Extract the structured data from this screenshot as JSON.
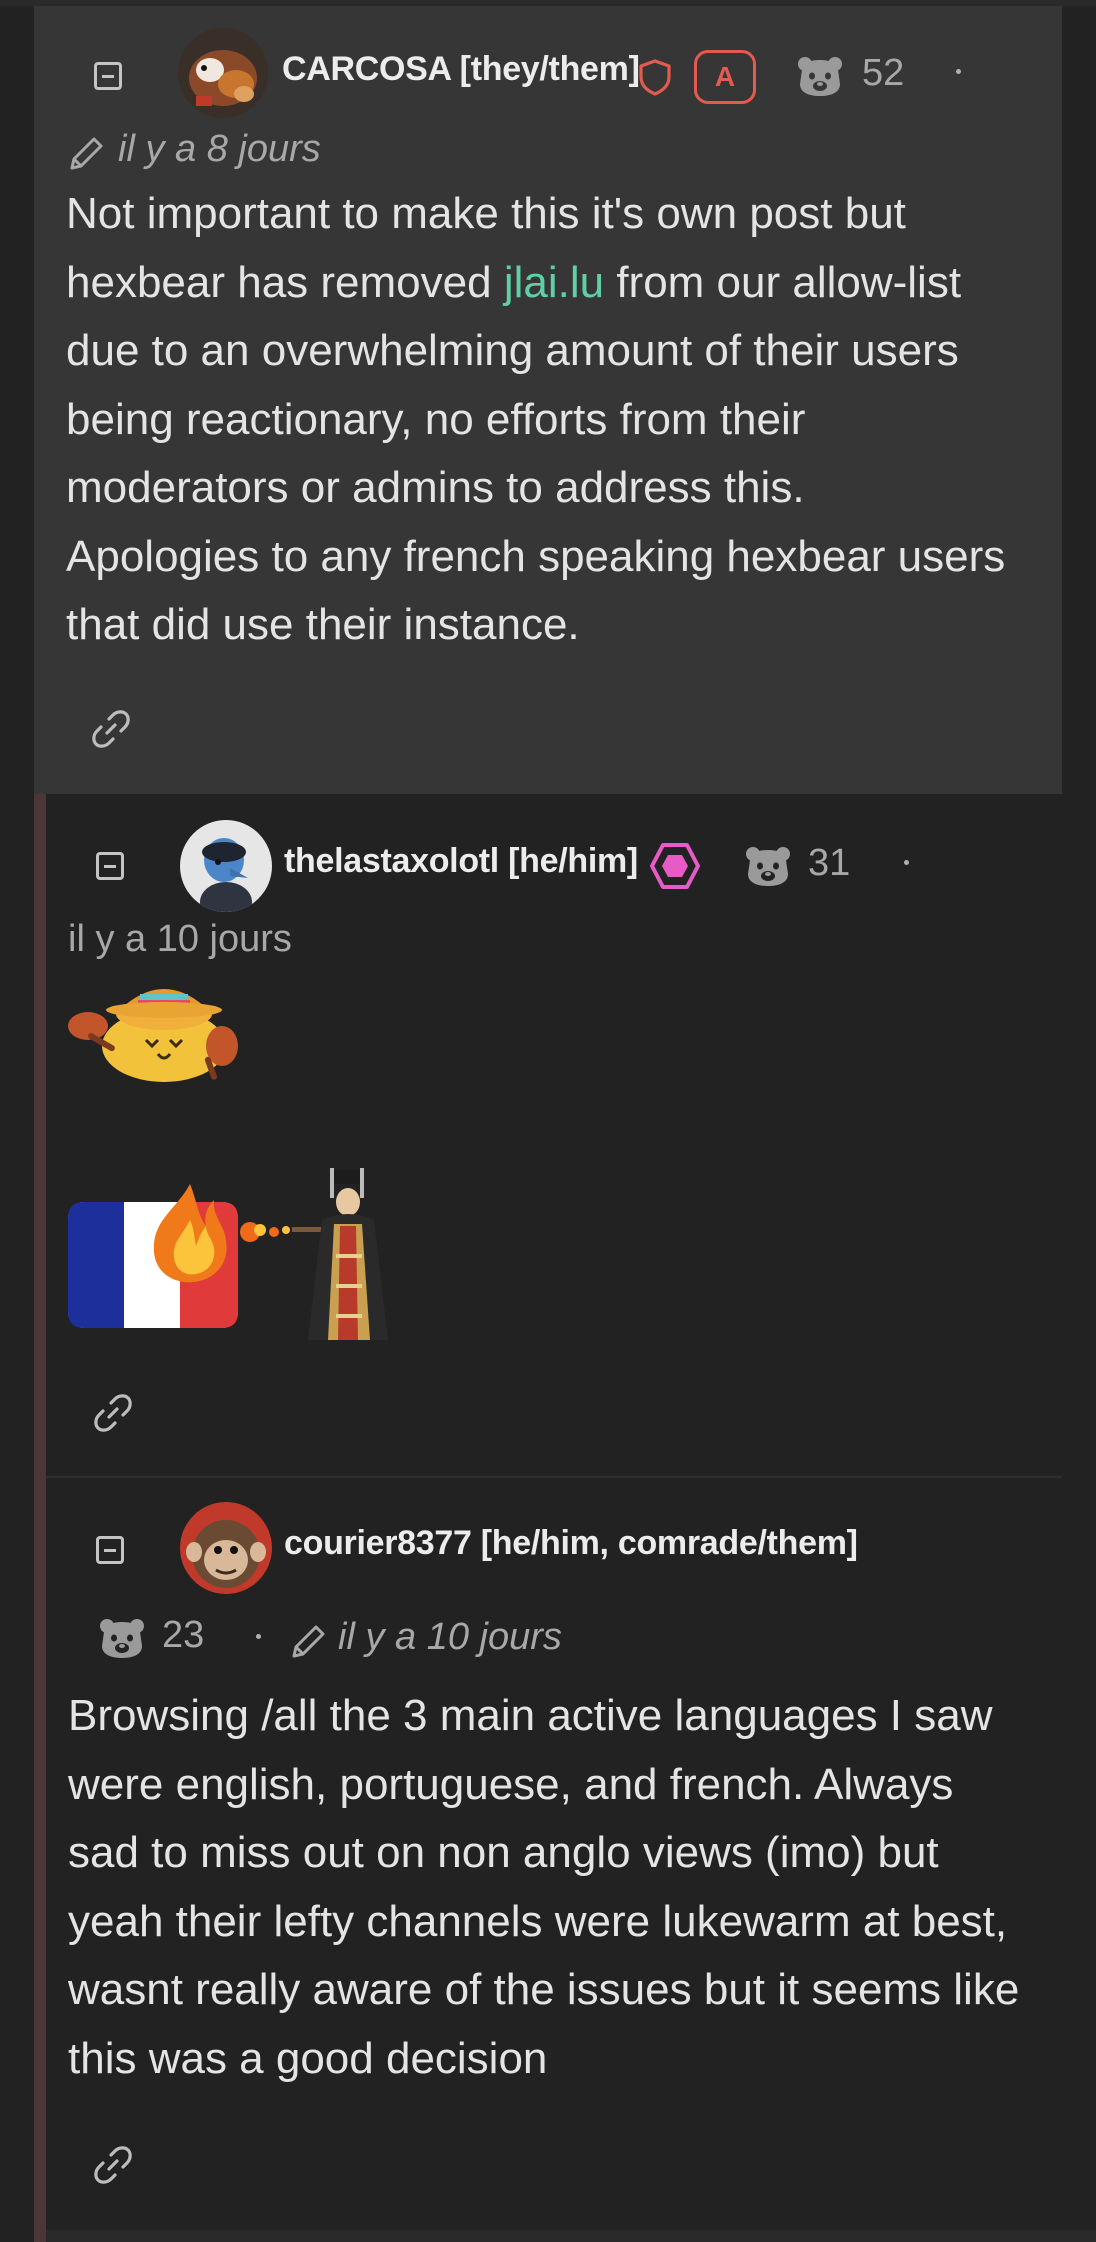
{
  "comments": [
    {
      "username": "CARCOSA [they/them]",
      "admin_badge": "A",
      "score": "52",
      "time": "il y a 8 jours",
      "body": {
        "line1": "Not important to make this it's own post but",
        "line2_pre": "hexbear has removed ",
        "line2_link": "jlai.lu",
        "line2_post": " from our allow-list",
        "line3": "due to an overwhelming amount of their users",
        "line4": "being reactionary, no efforts from their",
        "line5": "moderators or admins to address this.",
        "line6": "Apologies to any french speaking hexbear users",
        "line7": "that did use their instance."
      }
    },
    {
      "username": "thelastaxolotl [he/him]",
      "score": "31",
      "time": "il y a 10 jours"
    },
    {
      "username": "courier8377 [he/him, comrade/them]",
      "score": "23",
      "time": "il y a 10 jours",
      "body": {
        "line1": "Browsing /all the 3 main active languages I saw",
        "line2": "were english, portuguese, and french. Always",
        "line3": "sad to miss out on non anglo views (imo) but",
        "line4": "yeah their lefty channels were lukewarm at best,",
        "line5": "wasnt really aware of the issues but it seems like",
        "line6": "this was a good decision"
      }
    }
  ],
  "colors": {
    "background": "#222222",
    "highlight": "#363636",
    "link": "#5fd0a6",
    "mod_red": "#e35b4f",
    "pink_badge": "#e65bc6",
    "thread_line": "#4b3636"
  },
  "icons": [
    "collapse-icon",
    "avatar-image",
    "moderator-shield-icon",
    "admin-badge",
    "bear-score-icon",
    "edited-pencil-icon",
    "permalink-icon",
    "pink-hexagon-icon",
    "emoji-taco-maracas",
    "emoji-french-flag-fire",
    "emoji-emperor-flamethrower"
  ]
}
